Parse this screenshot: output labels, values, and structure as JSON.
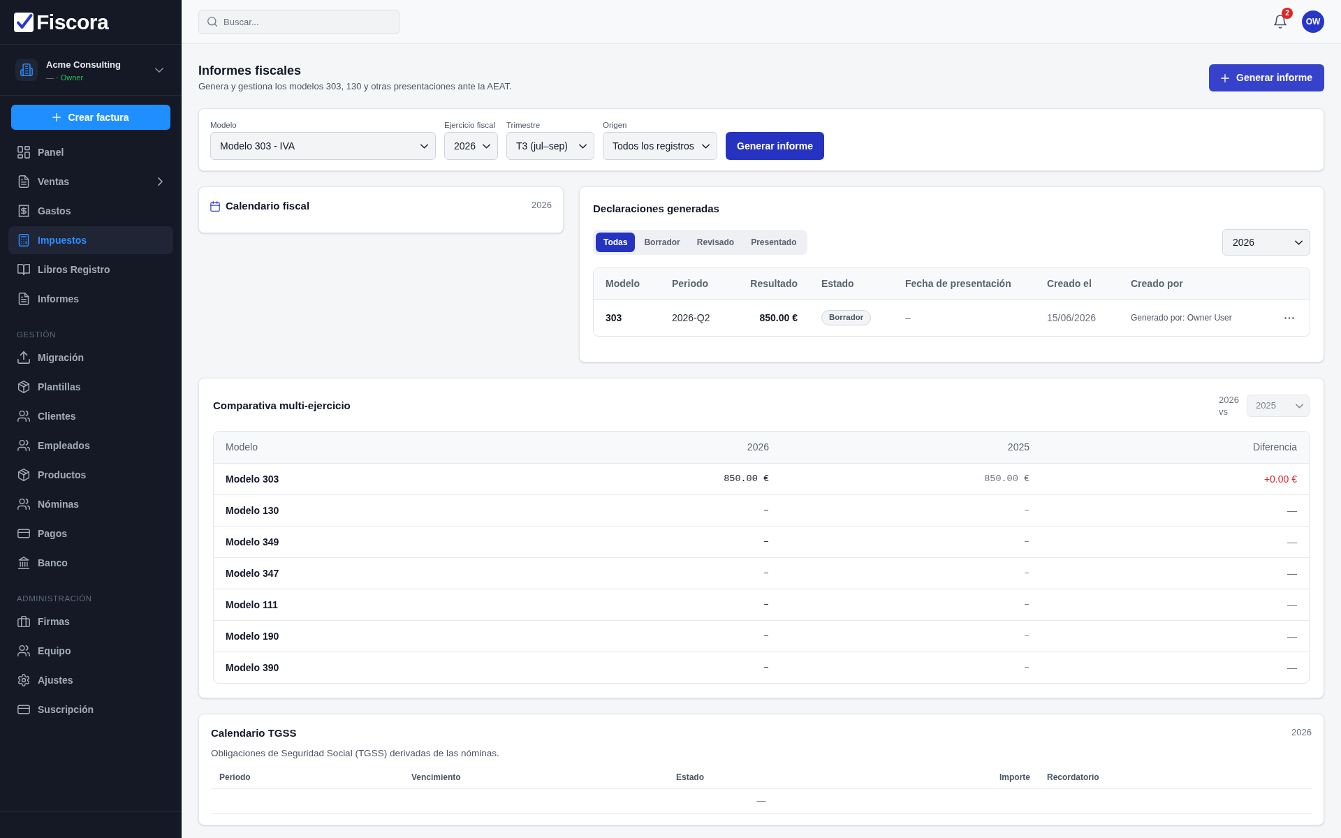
{
  "sidebar": {
    "logo": {
      "text": "Fiscora"
    },
    "organization": {
      "name": "Acme Consulting",
      "meta": "— ·",
      "role": "Owner"
    },
    "primary_action": "Crear factura",
    "sections": [
      {
        "items": [
          {
            "label": "Panel",
            "selected": false,
            "expandable": false
          },
          {
            "label": "Ventas",
            "selected": false,
            "expandable": true
          },
          {
            "label": "Gastos",
            "selected": false,
            "expandable": false
          },
          {
            "label": "Impuestos",
            "selected": true,
            "expandable": false
          },
          {
            "label": "Libros Registro",
            "selected": false,
            "expandable": false
          },
          {
            "label": "Informes",
            "selected": false,
            "expandable": false
          }
        ]
      },
      {
        "label": "GESTIÓN",
        "items": [
          {
            "label": "Migración",
            "selected": false,
            "expandable": false
          },
          {
            "label": "Plantillas",
            "selected": false,
            "expandable": false
          },
          {
            "label": "Clientes",
            "selected": false,
            "expandable": false
          },
          {
            "label": "Empleados",
            "selected": false,
            "expandable": false
          },
          {
            "label": "Productos",
            "selected": false,
            "expandable": false
          },
          {
            "label": "Nóminas",
            "selected": false,
            "expandable": false
          },
          {
            "label": "Pagos",
            "selected": false,
            "expandable": false
          },
          {
            "label": "Banco",
            "selected": false,
            "expandable": false
          }
        ]
      },
      {
        "label": "ADMINISTRACIÓN",
        "items": [
          {
            "label": "Firmas",
            "selected": false,
            "expandable": false
          },
          {
            "label": "Equipo",
            "selected": false,
            "expandable": false
          },
          {
            "label": "Ajustes",
            "selected": false,
            "expandable": false
          },
          {
            "label": "Suscripción",
            "selected": false,
            "expandable": false
          }
        ]
      }
    ]
  },
  "topbar": {
    "search": {
      "placeholder": "Buscar..."
    },
    "notifications": {
      "count": "2"
    },
    "avatar": {
      "initials": "OW"
    }
  },
  "header": {
    "title": "Informes fiscales",
    "subtitle": "Genera y gestiona los modelos 303, 130 y otras presentaciones ante la AEAT.",
    "action": "Generar informe"
  },
  "filters": {
    "fields": [
      {
        "label": "Modelo",
        "value": "Modelo 303 - IVA"
      },
      {
        "label": "Ejercicio fiscal",
        "value": "2026"
      },
      {
        "label": "Trimestre",
        "value": "T3 (jul–sep)"
      },
      {
        "label": "Origen",
        "value": "Todos los registros"
      }
    ],
    "action": "Generar informe"
  },
  "fiscal_calendar": {
    "title": "Calendario fiscal",
    "year": "2026"
  },
  "declarations": {
    "title": "Declaraciones generadas",
    "tabs": [
      {
        "label": "Todas",
        "selected": true
      },
      {
        "label": "Borrador",
        "selected": false
      },
      {
        "label": "Revisado",
        "selected": false
      },
      {
        "label": "Presentado",
        "selected": false
      }
    ],
    "year_select": {
      "value": "2026"
    },
    "table": {
      "columns": [
        "Modelo",
        "Periodo",
        "Resultado",
        "Estado",
        "Fecha de presentación",
        "Creado el",
        "Creado por"
      ],
      "rows": [
        {
          "modelo": "303",
          "periodo": "2026-Q2",
          "resultado": "850.00 €",
          "estado": "Borrador",
          "fecha_presentacion": "–",
          "creado_el": "15/06/2026",
          "creado_por": "Generado por: Owner User"
        }
      ]
    }
  },
  "comparison": {
    "title": "Comparativa multi-ejercicio",
    "compare_label": "2026 vs",
    "compare_select": {
      "value": "2025",
      "disabled": true
    },
    "table": {
      "columns": [
        "Modelo",
        "2026",
        "2025",
        "Diferencia"
      ],
      "rows": [
        {
          "model": "Modelo 303",
          "current": "850.00 €",
          "previous": "850.00 €",
          "difference": "+0.00 €",
          "increase": true
        },
        {
          "model": "Modelo 130",
          "current": "–",
          "previous": "–",
          "difference": "—",
          "increase": false
        },
        {
          "model": "Modelo 349",
          "current": "–",
          "previous": "–",
          "difference": "—",
          "increase": false
        },
        {
          "model": "Modelo 347",
          "current": "–",
          "previous": "–",
          "difference": "—",
          "increase": false
        },
        {
          "model": "Modelo 111",
          "current": "–",
          "previous": "–",
          "difference": "—",
          "increase": false
        },
        {
          "model": "Modelo 190",
          "current": "–",
          "previous": "–",
          "difference": "—",
          "increase": false
        },
        {
          "model": "Modelo 390",
          "current": "–",
          "previous": "–",
          "difference": "—",
          "increase": false
        }
      ]
    }
  },
  "tgss_calendar": {
    "title": "Calendario TGSS",
    "year": "2026",
    "subtitle": "Obligaciones de Seguridad Social (TGSS) derivadas de las nóminas.",
    "table": {
      "columns": [
        "Periodo",
        "Vencimiento",
        "Estado",
        "Importe",
        "Recordatorio"
      ],
      "empty_text": "—"
    }
  }
}
